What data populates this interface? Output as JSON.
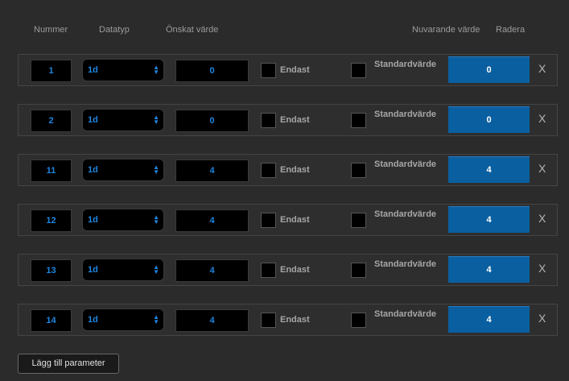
{
  "headers": {
    "number": "Nummer",
    "datatype": "Datatyp",
    "desired": "Önskat värde",
    "current": "Nuvarande värde",
    "delete": "Radera"
  },
  "rows": [
    {
      "number": "1",
      "datatype": "1d",
      "desired": "0",
      "only_label": "Endast",
      "default_label": "Standardvärde",
      "current": "0",
      "delete": "X",
      "show_only_label": true
    },
    {
      "number": "2",
      "datatype": "1d",
      "desired": "0",
      "only_label": "Endast",
      "default_label": "Standardvärde",
      "current": "0",
      "delete": "X",
      "show_only_label": true
    },
    {
      "number": "11",
      "datatype": "1d",
      "desired": "4",
      "only_label": "Endast",
      "default_label": "Standardvärde",
      "current": "4",
      "delete": "X",
      "show_only_label": true
    },
    {
      "number": "12",
      "datatype": "1d",
      "desired": "4",
      "only_label": "Endast",
      "default_label": "Standardvärde",
      "current": "4",
      "delete": "X",
      "show_only_label": true
    },
    {
      "number": "13",
      "datatype": "1d",
      "desired": "4",
      "only_label": "Endast",
      "default_label": "Standardvärde",
      "current": "4",
      "delete": "X",
      "show_only_label": true
    },
    {
      "number": "14",
      "datatype": "1d",
      "desired": "4",
      "only_label": "Endast",
      "default_label": "Standardvärde",
      "current": "4",
      "delete": "X",
      "show_only_label": true
    }
  ],
  "add_button": "Lägg till parameter",
  "colors": {
    "accent": "#1e86e0",
    "current_bg": "#0a5fa0",
    "background": "#2b2b2b"
  },
  "icons": {
    "select_arrow": "updown-arrow-icon",
    "delete": "close-icon"
  }
}
